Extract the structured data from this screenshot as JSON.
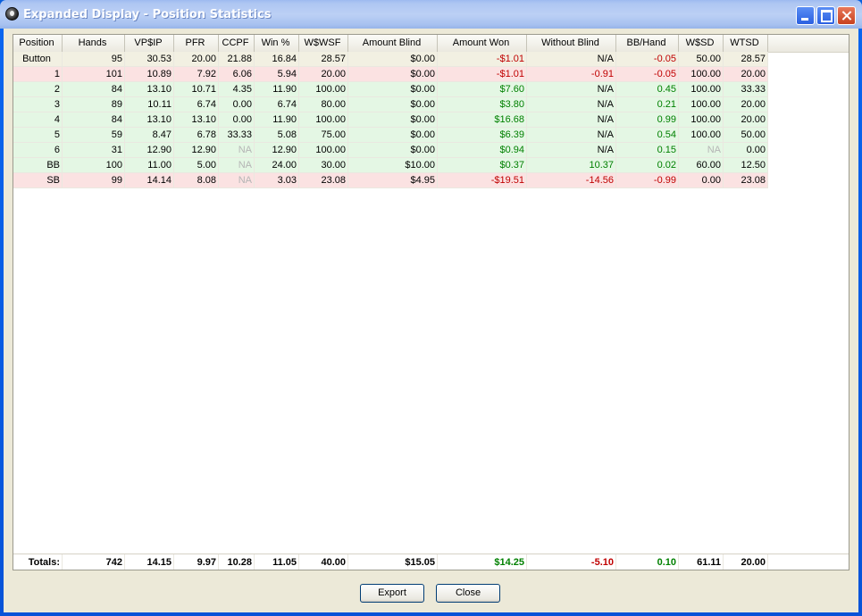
{
  "window": {
    "title": "Expanded Display - Position Statistics"
  },
  "columns": [
    "Position",
    "Hands",
    "VP$IP",
    "PFR",
    "CCPF",
    "Win %",
    "W$WSF",
    "Amount Blind",
    "Amount Won",
    "Without Blind",
    "BB/Hand",
    "W$SD",
    "WTSD"
  ],
  "rows": [
    [
      "Button",
      "95",
      "30.53",
      "20.00",
      "21.88",
      "16.84",
      "28.57",
      "$0.00",
      "-$1.01",
      "N/A",
      "-0.05",
      "50.00",
      "28.57"
    ],
    [
      "1",
      "101",
      "10.89",
      "7.92",
      "6.06",
      "5.94",
      "20.00",
      "$0.00",
      "-$1.01",
      "-0.91",
      "-0.05",
      "100.00",
      "20.00"
    ],
    [
      "2",
      "84",
      "13.10",
      "10.71",
      "4.35",
      "11.90",
      "100.00",
      "$0.00",
      "$7.60",
      "N/A",
      "0.45",
      "100.00",
      "33.33"
    ],
    [
      "3",
      "89",
      "10.11",
      "6.74",
      "0.00",
      "6.74",
      "80.00",
      "$0.00",
      "$3.80",
      "N/A",
      "0.21",
      "100.00",
      "20.00"
    ],
    [
      "4",
      "84",
      "13.10",
      "13.10",
      "0.00",
      "11.90",
      "100.00",
      "$0.00",
      "$16.68",
      "N/A",
      "0.99",
      "100.00",
      "20.00"
    ],
    [
      "5",
      "59",
      "8.47",
      "6.78",
      "33.33",
      "5.08",
      "75.00",
      "$0.00",
      "$6.39",
      "N/A",
      "0.54",
      "100.00",
      "50.00"
    ],
    [
      "6",
      "31",
      "12.90",
      "12.90",
      "NA",
      "12.90",
      "100.00",
      "$0.00",
      "$0.94",
      "N/A",
      "0.15",
      "NA",
      "0.00"
    ],
    [
      "BB",
      "100",
      "11.00",
      "5.00",
      "NA",
      "24.00",
      "30.00",
      "$10.00",
      "$0.37",
      "10.37",
      "0.02",
      "60.00",
      "12.50"
    ],
    [
      "SB",
      "99",
      "14.14",
      "8.08",
      "NA",
      "3.03",
      "23.08",
      "$4.95",
      "-$19.51",
      "-14.56",
      "-0.99",
      "0.00",
      "23.08"
    ]
  ],
  "row_colors": {
    "neutral": "#f2f0e2",
    "positive": "#e4f7e4",
    "negative": "#fbe2e2",
    "text_positive": "#008000",
    "text_negative": "#c00000"
  },
  "totals": [
    "Totals:",
    "742",
    "14.15",
    "9.97",
    "10.28",
    "11.05",
    "40.00",
    "$15.05",
    "$14.25",
    "-5.10",
    "0.10",
    "61.11",
    "20.00"
  ],
  "buttons": {
    "export": "Export",
    "close": "Close"
  }
}
